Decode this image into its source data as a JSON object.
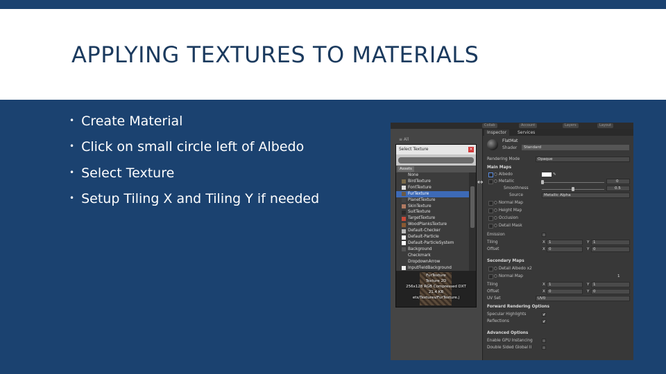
{
  "slide": {
    "title": "APPLYING TEXTURES TO MATERIALS",
    "bullets": [
      "Create Material",
      "Click on small circle left of Albedo",
      "Select Texture",
      "Setup Tiling X and Tiling Y if needed"
    ],
    "colors": {
      "background": "#1b4270",
      "title_band": "#ffffff",
      "title_text": "#1b3a5e",
      "bullet_text": "#ffffff"
    }
  },
  "unity": {
    "toolbar": {
      "btn1": "Collab",
      "btn2": "Account",
      "btn3": "Layers",
      "btn4": "Layout"
    },
    "scene_label": "≡ All",
    "inspector": {
      "tabs": [
        "Inspector",
        "Services"
      ],
      "material_name": "FlatMat",
      "shader_label": "Shader",
      "shader_value": "Standard",
      "rendering_mode_label": "Rendering Mode",
      "rendering_mode_value": "Opaque",
      "main_maps": "Main Maps",
      "albedo": "○ Albedo",
      "metallic": "○ Metallic",
      "smoothness": "Smoothness",
      "smoothness_value": "0.5",
      "metallic_value": "0",
      "source": "Source",
      "source_value": "Metallic Alpha",
      "normal_map": "○ Normal Map",
      "height_map": "○ Height Map",
      "occlusion": "○ Occlusion",
      "detail_mask": "○ Detail Mask",
      "emission": "Emission",
      "tiling": "Tiling",
      "offset": "Offset",
      "x_label": "X",
      "y_label": "Y",
      "tiling_x": "1",
      "tiling_y": "1",
      "offset_x": "0",
      "offset_y": "0",
      "secondary_maps": "Secondary Maps",
      "detail_albedo": "○ Detail Albedo x2",
      "sec_normal_map": "○ Normal Map",
      "sec_normal_value": "1",
      "sec_tiling": "Tiling",
      "sec_offset": "Offset",
      "sec_tiling_x": "1",
      "sec_tiling_y": "1",
      "sec_offset_x": "0",
      "sec_offset_y": "0",
      "uv_set": "UV Set",
      "uv_set_value": "UV0",
      "forward_options": "Forward Rendering Options",
      "specular_highlights": "Specular Highlights",
      "reflections": "Reflections",
      "advanced_options": "Advanced Options",
      "enable_gpu": "Enable GPU Instancing",
      "double_sided": "Double Sided Global Il"
    },
    "select_texture": {
      "title": "Select Texture",
      "close": "×",
      "search_value": "",
      "assets_tab": "Assets",
      "items": [
        {
          "name": "None",
          "thumb": "#3c3c3c"
        },
        {
          "name": "BirdTexture",
          "thumb": "#7a6a4a"
        },
        {
          "name": "FontTexture",
          "thumb": "#dddddd"
        },
        {
          "name": "FurTexture",
          "thumb": "#6b5a46"
        },
        {
          "name": "PlanetTexture",
          "thumb": "#444444"
        },
        {
          "name": "SkinTexture",
          "thumb": "#b07a62"
        },
        {
          "name": "SuitTexture",
          "thumb": "#2a2a2a"
        },
        {
          "name": "TargetTexture",
          "thumb": "#c84a3a"
        },
        {
          "name": "WoodPlanksTexture",
          "thumb": "#8a5a32"
        },
        {
          "name": "Default-Checker",
          "thumb": "#bbbbbb"
        },
        {
          "name": "Default-Particle",
          "thumb": "#ffffff"
        },
        {
          "name": "Default-ParticleSystem",
          "thumb": "#ffffff"
        },
        {
          "name": "Background",
          "thumb": "#555555"
        },
        {
          "name": "Checkmark",
          "thumb": "#3c3c3c"
        },
        {
          "name": "DropdownArrow",
          "thumb": "#3c3c3c"
        },
        {
          "name": "InputFieldBackground",
          "thumb": "#eeeeee"
        },
        {
          "name": "Knob",
          "thumb": "#3c3c3c"
        }
      ],
      "selected_index": 3,
      "preview_info": [
        "FurTexture",
        "Texture 2D",
        "256x128  RGB Compressed DXT",
        "21.4 KB",
        "ets/Textures/FurTexture.j"
      ]
    }
  }
}
